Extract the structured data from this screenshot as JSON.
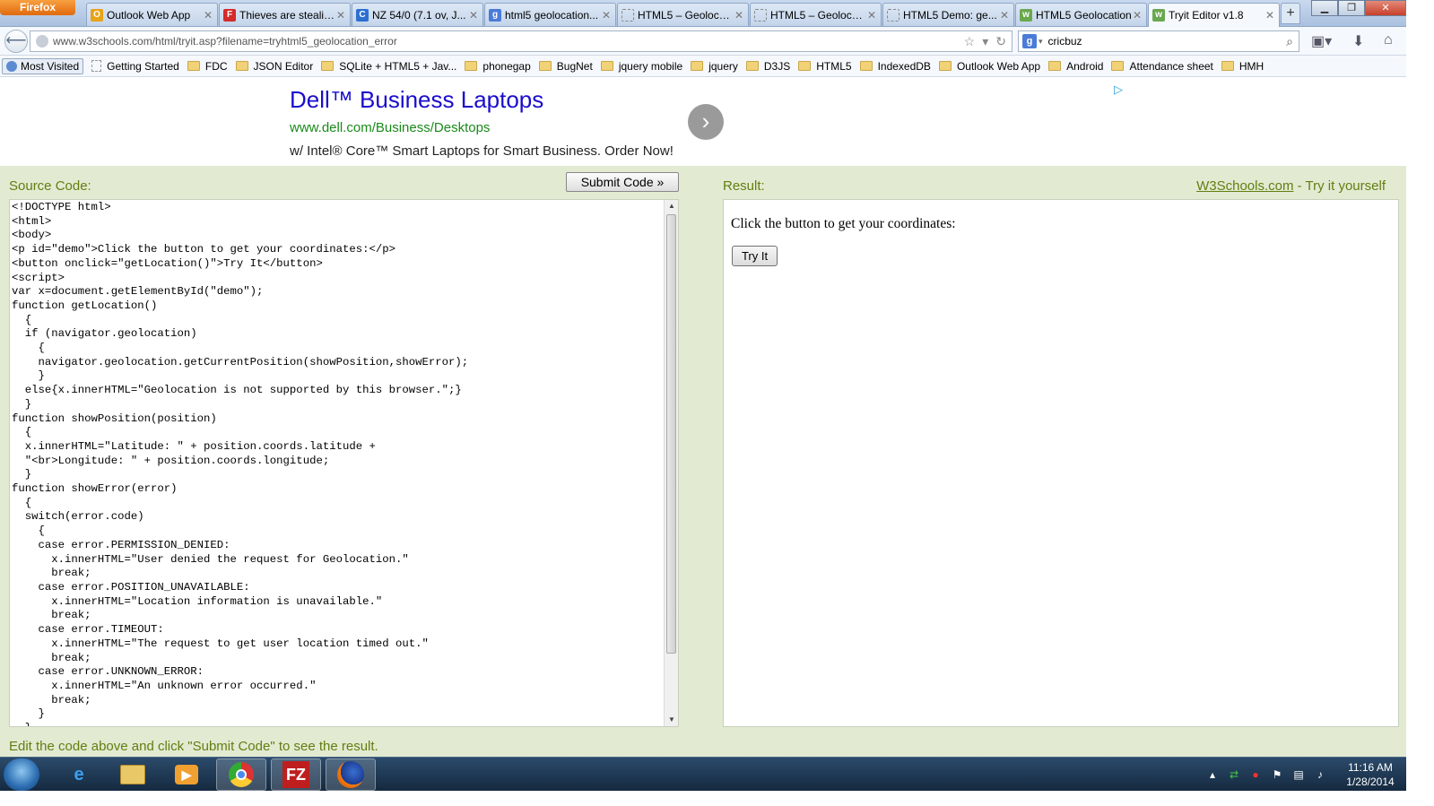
{
  "browser": {
    "menu_label": "Firefox",
    "tabs": [
      {
        "title": "Outlook Web App",
        "icon": "outlook-icon",
        "color": "#e8a317",
        "glyph": "O"
      },
      {
        "title": "Thieves are stealin...",
        "icon": "news-icon",
        "color": "#d42b2b",
        "glyph": "F"
      },
      {
        "title": "NZ 54/0 (7.1 ov, J...",
        "icon": "cricbuzz-icon",
        "color": "#2d6fd1",
        "glyph": "C"
      },
      {
        "title": "html5 geolocation...",
        "icon": "google-icon",
        "color": "#4a7bd8",
        "glyph": "g"
      },
      {
        "title": "HTML5 – Geoloca...",
        "icon": "blank-page-icon",
        "color": "",
        "glyph": ""
      },
      {
        "title": "HTML5 – Geoloca...",
        "icon": "blank-page-icon",
        "color": "",
        "glyph": ""
      },
      {
        "title": "HTML5 Demo: ge...",
        "icon": "blank-page-icon",
        "color": "",
        "glyph": ""
      },
      {
        "title": "HTML5 Geolocation",
        "icon": "w3schools-icon",
        "color": "#6aa84f",
        "glyph": "w"
      },
      {
        "title": "Tryit Editor v1.8",
        "icon": "w3schools-icon",
        "color": "#6aa84f",
        "glyph": "w",
        "active": true
      }
    ],
    "url": "www.w3schools.com/html/tryit.asp?filename=tryhtml5_geolocation_error",
    "search_value": "cricbuz",
    "bookmarks": [
      {
        "label": "Most Visited",
        "type": "mostvisited"
      },
      {
        "label": "Getting Started",
        "type": "page"
      },
      {
        "label": "FDC",
        "type": "folder"
      },
      {
        "label": "JSON Editor",
        "type": "folder"
      },
      {
        "label": "SQLite + HTML5 + Jav...",
        "type": "folder"
      },
      {
        "label": "phonegap",
        "type": "folder"
      },
      {
        "label": "BugNet",
        "type": "folder"
      },
      {
        "label": "jquery mobile",
        "type": "folder"
      },
      {
        "label": "jquery",
        "type": "folder"
      },
      {
        "label": "D3JS",
        "type": "folder"
      },
      {
        "label": "HTML5",
        "type": "folder"
      },
      {
        "label": "IndexedDB",
        "type": "folder"
      },
      {
        "label": "Outlook Web App",
        "type": "folder"
      },
      {
        "label": "Android",
        "type": "folder"
      },
      {
        "label": "Attendance sheet",
        "type": "folder"
      },
      {
        "label": "HMH",
        "type": "folder"
      }
    ]
  },
  "ad": {
    "title": "Dell™ Business Laptops",
    "url": "www.dell.com/Business/Desktops",
    "description": "w/ Intel® Core™ Smart Laptops for Smart Business. Order Now!"
  },
  "editor": {
    "source_label": "Source Code:",
    "submit_label": "Submit Code »",
    "code": "<!DOCTYPE html>\n<html>\n<body>\n<p id=\"demo\">Click the button to get your coordinates:</p>\n<button onclick=\"getLocation()\">Try It</button>\n<script>\nvar x=document.getElementById(\"demo\");\nfunction getLocation()\n  {\n  if (navigator.geolocation)\n    {\n    navigator.geolocation.getCurrentPosition(showPosition,showError);\n    }\n  else{x.innerHTML=\"Geolocation is not supported by this browser.\";}\n  }\nfunction showPosition(position)\n  {\n  x.innerHTML=\"Latitude: \" + position.coords.latitude + \n  \"<br>Longitude: \" + position.coords.longitude;\n  }\nfunction showError(error)\n  {\n  switch(error.code)\n    {\n    case error.PERMISSION_DENIED:\n      x.innerHTML=\"User denied the request for Geolocation.\"\n      break;\n    case error.POSITION_UNAVAILABLE:\n      x.innerHTML=\"Location information is unavailable.\"\n      break;\n    case error.TIMEOUT:\n      x.innerHTML=\"The request to get user location timed out.\"\n      break;\n    case error.UNKNOWN_ERROR:\n      x.innerHTML=\"An unknown error occurred.\"\n      break;\n    }\n  }",
    "result_label": "Result:",
    "w3_link": "W3Schools.com",
    "try_yourself": " - Try it yourself",
    "result_text": "Click the button to get your coordinates:",
    "try_button": "Try It",
    "footer": "Edit the code above and click \"Submit Code\" to see the result."
  },
  "taskbar": {
    "time": "11:16 AM",
    "date": "1/28/2014"
  }
}
